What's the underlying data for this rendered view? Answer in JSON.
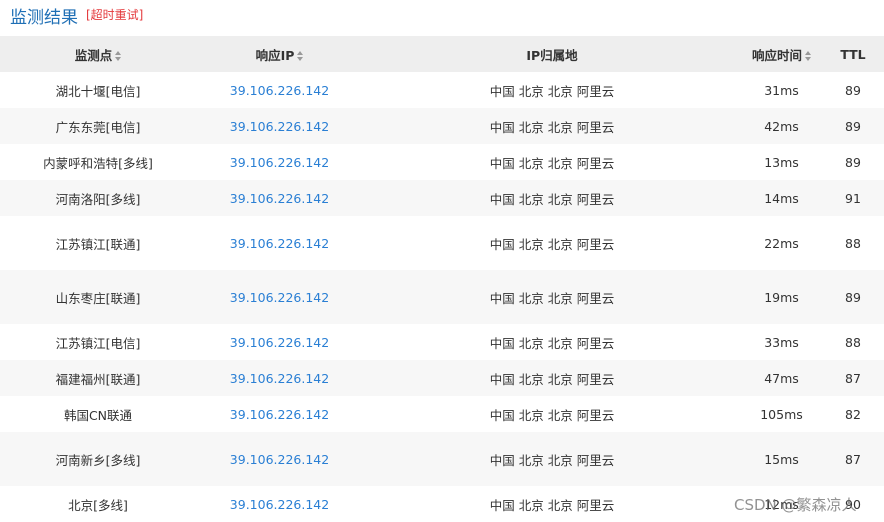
{
  "header": {
    "title": "监测结果",
    "retry_label": "[超时重试]"
  },
  "columns": [
    {
      "label": "监测点",
      "sortable": true
    },
    {
      "label": "响应IP",
      "sortable": true
    },
    {
      "label": "IP归属地",
      "sortable": false
    },
    {
      "label": "响应时间",
      "sortable": true
    },
    {
      "label": "TTL",
      "sortable": false
    }
  ],
  "rows": [
    {
      "node": "湖北十堰[电信]",
      "ip": "39.106.226.142",
      "location": "中国 北京 北京 阿里云",
      "time": "31ms",
      "ttl": "89"
    },
    {
      "node": "广东东莞[电信]",
      "ip": "39.106.226.142",
      "location": "中国 北京 北京 阿里云",
      "time": "42ms",
      "ttl": "89"
    },
    {
      "node": "内蒙呼和浩特[多线]",
      "ip": "39.106.226.142",
      "location": "中国 北京 北京 阿里云",
      "time": "13ms",
      "ttl": "89"
    },
    {
      "node": "河南洛阳[多线]",
      "ip": "39.106.226.142",
      "location": "中国 北京 北京 阿里云",
      "time": "14ms",
      "ttl": "91"
    },
    {
      "node": "江苏镇江[联通]",
      "ip": "39.106.226.142",
      "location": "中国 北京 北京 阿里云",
      "time": "22ms",
      "ttl": "88"
    },
    {
      "node": "山东枣庄[联通]",
      "ip": "39.106.226.142",
      "location": "中国 北京 北京 阿里云",
      "time": "19ms",
      "ttl": "89"
    },
    {
      "node": "江苏镇江[电信]",
      "ip": "39.106.226.142",
      "location": "中国 北京 北京 阿里云",
      "time": "33ms",
      "ttl": "88"
    },
    {
      "node": "福建福州[联通]",
      "ip": "39.106.226.142",
      "location": "中国 北京 北京 阿里云",
      "time": "47ms",
      "ttl": "87"
    },
    {
      "node": "韩国CN联通",
      "ip": "39.106.226.142",
      "location": "中国 北京 北京 阿里云",
      "time": "105ms",
      "ttl": "82"
    },
    {
      "node": "河南新乡[多线]",
      "ip": "39.106.226.142",
      "location": "中国 北京 北京 阿里云",
      "time": "15ms",
      "ttl": "87"
    },
    {
      "node": "北京[多线]",
      "ip": "39.106.226.142",
      "location": "中国 北京 北京 阿里云",
      "time": "12ms",
      "ttl": "90"
    }
  ],
  "watermark": "CSDN @繁森凉人"
}
